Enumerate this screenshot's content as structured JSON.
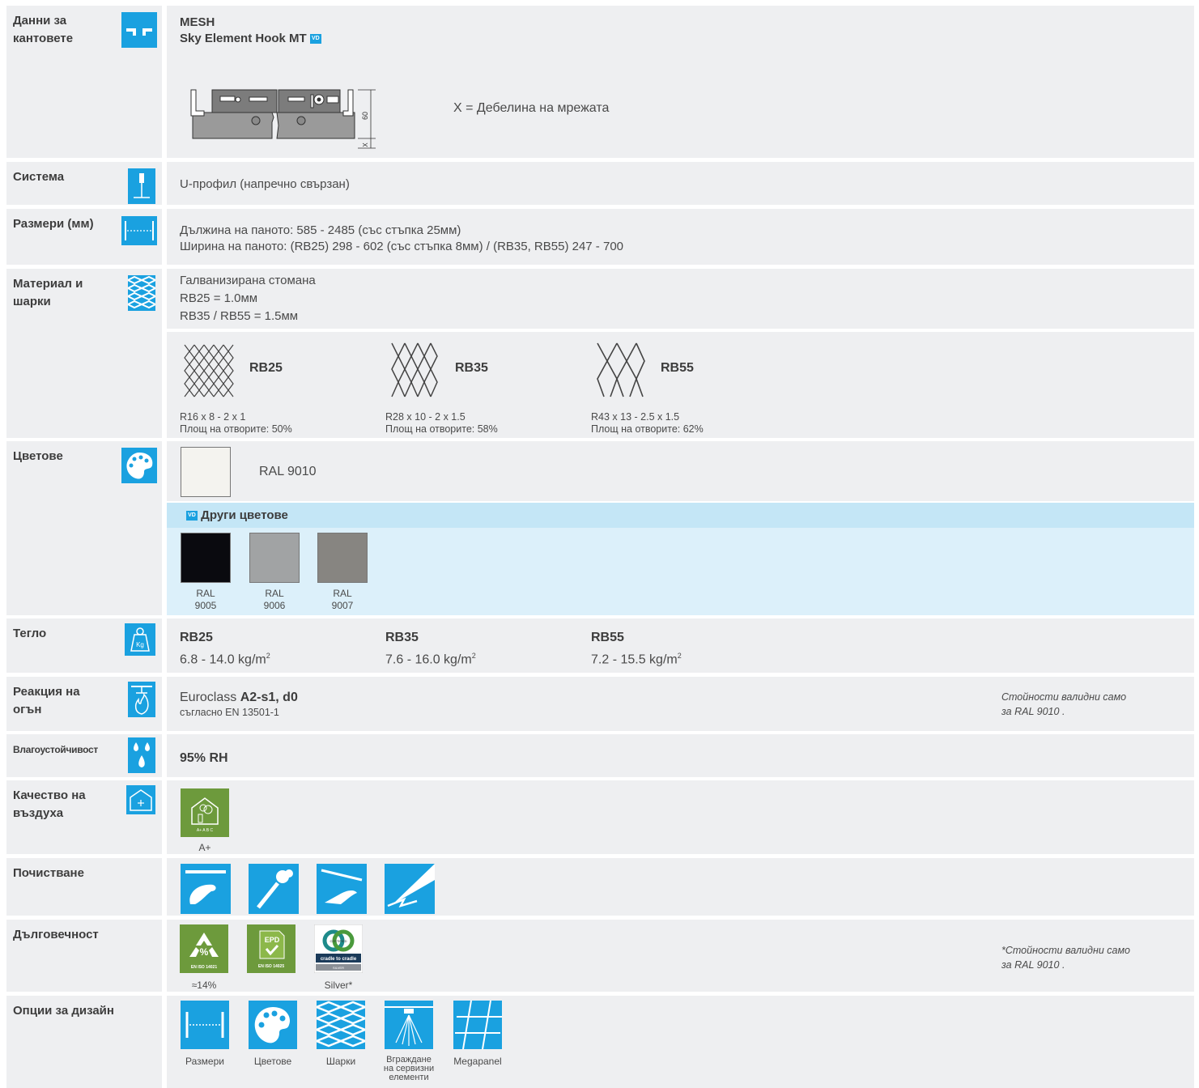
{
  "header": {
    "label": "Данни за кантовете",
    "brand": "MESH",
    "product": "Sky Element Hook MT",
    "vd_badge": "VD",
    "thickness_label": "X = Дебелина на мрежата",
    "dim_60": "60",
    "dim_x": "X"
  },
  "system": {
    "label": "Система",
    "value": "U-профил (напречно свързан)"
  },
  "dimensions": {
    "label": "Размери (мм)",
    "length": "Дължина на паното: 585 - 2485 (със стъпка 25мм)",
    "width": "Ширина на паното: (RB25) 298 - 602 (със стъпка 8мм) / (RB35, RB55) 247 - 700"
  },
  "material": {
    "label": "Материал и шарки",
    "lines": [
      "Галванизирана стомана",
      "RB25 = 1.0мм",
      "RB35 / RB55 = 1.5мм"
    ],
    "patterns": [
      {
        "name": "RB25",
        "spec": "R16 x 8 - 2 x 1",
        "open": "Площ на отворите: 50%"
      },
      {
        "name": "RB35",
        "spec": "R28 x 10 - 2 x 1.5",
        "open": "Площ на отворите: 58%"
      },
      {
        "name": "RB55",
        "spec": "R43 x 13 - 2.5 x 1.5",
        "open": "Площ на отворите: 62%"
      }
    ]
  },
  "colors": {
    "label": "Цветове",
    "standard": {
      "name": "RAL 9010",
      "hex": "#f4f3ef"
    },
    "other_title": "Други цветове",
    "other": [
      {
        "l1": "RAL",
        "l2": "9005",
        "hex": "#0a0a0f"
      },
      {
        "l1": "RAL",
        "l2": "9006",
        "hex": "#a1a3a4"
      },
      {
        "l1": "RAL",
        "l2": "9007",
        "hex": "#878581"
      }
    ]
  },
  "weight": {
    "label": "Тегло",
    "icon_text": "Kg",
    "items": [
      {
        "name": "RB25",
        "value": "6.8 - 14.0 kg/m",
        "sup": "2"
      },
      {
        "name": "RB35",
        "value": "7.6 - 16.0 kg/m",
        "sup": "2"
      },
      {
        "name": "RB55",
        "value": "7.2 - 15.5 kg/m",
        "sup": "2"
      }
    ]
  },
  "fire": {
    "label": "Реакция на огън",
    "prefix": "Euroclass ",
    "class": "A2-s1, d0",
    "norm": "съгласно EN 13501-1",
    "note1": "Стойности валидни само",
    "note2": "за RAL 9010 ."
  },
  "humidity": {
    "label": "Влагоустойчивост",
    "value": "95% RH"
  },
  "air": {
    "label": "Качество на въздуха",
    "value": "A+",
    "scale": "A+ A B C"
  },
  "cleaning": {
    "label": "Почистване"
  },
  "sustain": {
    "label": "Дълговечност",
    "iso14021": "EN ISO 14021",
    "recycle_pct": "%",
    "iso14025": "EN ISO 14025",
    "epd": "EPD",
    "c2c_certified": "CERTIFIED",
    "c2c_name": "cradle to cradle",
    "c2c_level": "SILVER",
    "recycle_cap": "≈14%",
    "c2c_cap": "Silver*",
    "note1": "*Стойности валидни само",
    "note2": "за RAL 9010 ."
  },
  "design": {
    "label": "Опции за дизайн",
    "options": [
      {
        "l1": "Размери",
        "l2": "",
        "l3": ""
      },
      {
        "l1": "Цветове",
        "l2": "",
        "l3": ""
      },
      {
        "l1": "Шарки",
        "l2": "",
        "l3": ""
      },
      {
        "l1": "Вграждане",
        "l2": "на сервизни",
        "l3": "елементи"
      },
      {
        "l1": "Megapanel",
        "l2": "",
        "l3": ""
      }
    ]
  },
  "theme": {
    "accent": "#1aa1e0",
    "green": "#6d9a3c",
    "light_blue": "#dcf0fa",
    "blue_header": "#c4e6f6",
    "panel": "#eeeff1"
  }
}
